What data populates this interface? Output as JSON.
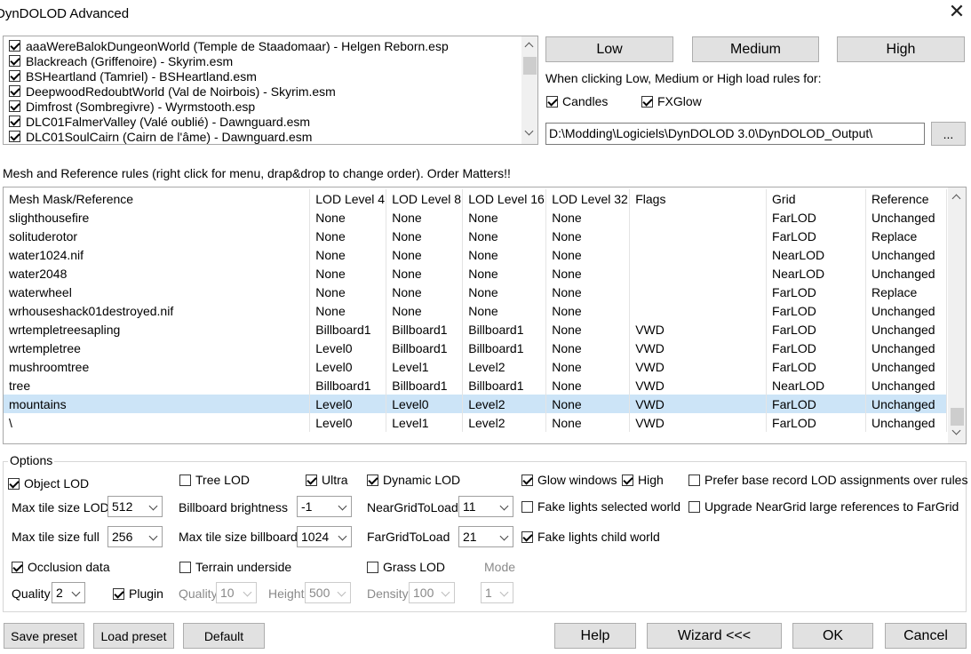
{
  "window": {
    "title": "DynDOLOD Advanced",
    "close_glyph": "✕"
  },
  "worldspaces": [
    {
      "label": "aaaWereBalokDungeonWorld (Temple de Staadomaar) - Helgen Reborn.esp",
      "checked": true
    },
    {
      "label": "Blackreach (Griffenoire) - Skyrim.esm",
      "checked": true
    },
    {
      "label": "BSHeartland (Tamriel) - BSHeartland.esm",
      "checked": true
    },
    {
      "label": "DeepwoodRedoubtWorld (Val de Noirbois) - Skyrim.esm",
      "checked": true
    },
    {
      "label": "Dimfrost (Sombregivre) - Wyrmstooth.esp",
      "checked": true
    },
    {
      "label": "DLC01FalmerValley (Valé oublié) - Dawnguard.esm",
      "checked": true
    },
    {
      "label": "DLC01SoulCairn (Cairn de l'âme) - Dawnguard.esm",
      "checked": true
    }
  ],
  "presets_buttons": {
    "low": "Low",
    "medium": "Medium",
    "high": "High"
  },
  "load_rules_text": "When clicking Low, Medium or High load rules for:",
  "candles": {
    "label": "Candles",
    "checked": true
  },
  "fxglow": {
    "label": "FXGlow",
    "checked": true
  },
  "output_path": "D:\\Modding\\Logiciels\\DynDOLOD 3.0\\DynDOLOD_Output\\",
  "browse_label": "...",
  "rules_caption": "Mesh and Reference rules (right click for menu, drap&drop to change order). Order Matters!!",
  "rules_table": {
    "headers": [
      "Mesh Mask/Reference",
      "LOD Level 4",
      "LOD Level 8",
      "LOD Level 16",
      "LOD Level 32",
      "Flags",
      "Grid",
      "Reference"
    ],
    "rows": [
      [
        "slighthousefire",
        "None",
        "None",
        "None",
        "None",
        "",
        "FarLOD",
        "Unchanged"
      ],
      [
        "solituderotor",
        "None",
        "None",
        "None",
        "None",
        "",
        "FarLOD",
        "Replace"
      ],
      [
        "water1024.nif",
        "None",
        "None",
        "None",
        "None",
        "",
        "NearLOD",
        "Unchanged"
      ],
      [
        "water2048",
        "None",
        "None",
        "None",
        "None",
        "",
        "NearLOD",
        "Unchanged"
      ],
      [
        "waterwheel",
        "None",
        "None",
        "None",
        "None",
        "",
        "FarLOD",
        "Replace"
      ],
      [
        "wrhouseshack01destroyed.nif",
        "None",
        "None",
        "None",
        "None",
        "",
        "FarLOD",
        "Unchanged"
      ],
      [
        "wrtempletreesapling",
        "Billboard1",
        "Billboard1",
        "Billboard1",
        "None",
        "VWD",
        "FarLOD",
        "Unchanged"
      ],
      [
        "wrtempletree",
        "Level0",
        "Billboard1",
        "Billboard1",
        "None",
        "VWD",
        "FarLOD",
        "Unchanged"
      ],
      [
        "mushroomtree",
        "Level0",
        "Level1",
        "Level2",
        "None",
        "VWD",
        "FarLOD",
        "Unchanged"
      ],
      [
        "tree",
        "Billboard1",
        "Billboard1",
        "Billboard1",
        "None",
        "VWD",
        "NearLOD",
        "Unchanged"
      ],
      [
        "mountains",
        "Level0",
        "Level0",
        "Level2",
        "None",
        "VWD",
        "FarLOD",
        "Unchanged"
      ],
      [
        "\\",
        "Level0",
        "Level1",
        "Level2",
        "None",
        "VWD",
        "FarLOD",
        "Unchanged"
      ]
    ],
    "selected_row": 10
  },
  "options": {
    "group_label": "Options",
    "object_lod": {
      "label": "Object LOD",
      "checked": true
    },
    "tree_lod": {
      "label": "Tree LOD",
      "checked": false
    },
    "ultra": {
      "label": "Ultra",
      "checked": true
    },
    "dynamic_lod": {
      "label": "Dynamic LOD",
      "checked": true
    },
    "glow_windows": {
      "label": "Glow windows",
      "checked": true
    },
    "high": {
      "label": "High",
      "checked": true
    },
    "prefer_base": {
      "label": "Prefer base record LOD assignments over rules",
      "checked": false
    },
    "max_tile_lod": {
      "label": "Max tile size LOD",
      "value": "512"
    },
    "billboard_brightness": {
      "label": "Billboard brightness",
      "value": "-1"
    },
    "near_grid": {
      "label": "NearGridToLoad",
      "value": "11"
    },
    "fake_lights_selected": {
      "label": "Fake lights selected world",
      "checked": false
    },
    "upgrade_neargrid": {
      "label": "Upgrade NearGrid large references to FarGrid",
      "checked": false
    },
    "max_tile_full": {
      "label": "Max tile size full",
      "value": "256"
    },
    "max_tile_billboard": {
      "label": "Max tile size billboard",
      "value": "1024"
    },
    "far_grid": {
      "label": "FarGridToLoad",
      "value": "21"
    },
    "fake_lights_child": {
      "label": "Fake lights child world",
      "checked": true
    },
    "occlusion": {
      "label": "Occlusion data",
      "checked": true
    },
    "terrain_underside": {
      "label": "Terrain underside",
      "checked": false
    },
    "grass_lod": {
      "label": "Grass LOD",
      "checked": false
    },
    "mode": {
      "label": "Mode",
      "value": "1"
    },
    "quality": {
      "label": "Quality",
      "value": "2"
    },
    "plugin": {
      "label": "Plugin",
      "checked": true
    },
    "terrain_quality": {
      "label": "Quality",
      "value": "10"
    },
    "terrain_height": {
      "label": "Height",
      "value": "500"
    },
    "grass_density": {
      "label": "Density",
      "value": "100"
    }
  },
  "footer": {
    "save_preset": "Save preset",
    "load_preset": "Load preset",
    "default": "Default",
    "help": "Help",
    "wizard": "Wizard <<<",
    "ok": "OK",
    "cancel": "Cancel"
  },
  "colors": {
    "selection": "#cce4f7",
    "button_bg": "#e1e1e1"
  }
}
